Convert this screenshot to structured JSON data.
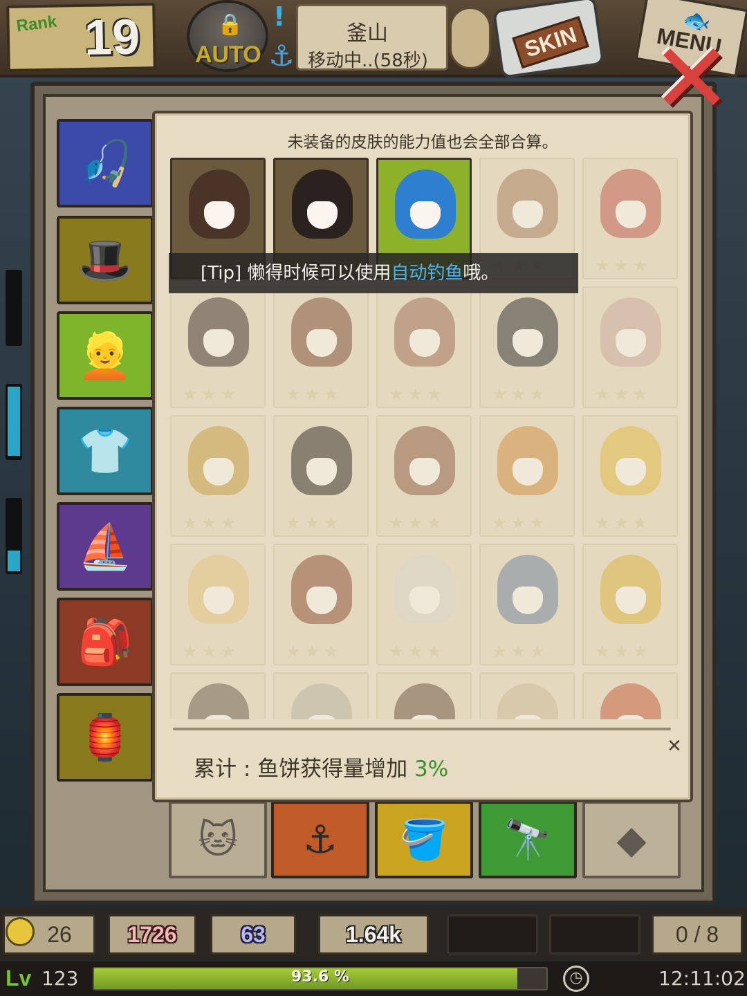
{
  "hud": {
    "rank_label": "Rank",
    "rank_value": "19",
    "auto_label": "AUTO",
    "location_name": "釜山",
    "location_status": "移动中..(58秒)",
    "skin_label": "SKIN",
    "menu_label": "MENU"
  },
  "skin_panel": {
    "header": "未装备的皮肤的能力值也会全部合算。",
    "tip_prefix": "[Tip] 懒得时候可以使用",
    "tip_link": "自动钓鱼",
    "tip_suffix": "哦。",
    "footer_label": "累计 : 鱼饼获得量增加 ",
    "footer_value": "3%",
    "star_glyphs": "★★★",
    "close_glyph": "✕"
  },
  "tabs": [
    {
      "name": "fishing-rod",
      "color": "#3b4aa8",
      "glyph": "🎣"
    },
    {
      "name": "hat",
      "color": "#8a7a1e",
      "glyph": "🎩"
    },
    {
      "name": "hair",
      "color": "#7fb52a",
      "glyph": "👱"
    },
    {
      "name": "clothes",
      "color": "#2f8aa0",
      "glyph": "👕"
    },
    {
      "name": "boat",
      "color": "#5e3a8f",
      "glyph": "⛵"
    },
    {
      "name": "bag",
      "color": "#8b3a25",
      "glyph": "🎒"
    },
    {
      "name": "lantern",
      "color": "#8a7a1e",
      "glyph": "🏮"
    }
  ],
  "hair_colors": [
    "#4a3428",
    "#2b2220",
    "#2f7fd0",
    "#a77a58",
    "#c0584a",
    "#3a2e2a",
    "#7a4a32",
    "#9a6a4c",
    "#2a2a2a",
    "#caa89a",
    "#c49a3c",
    "#2f2622",
    "#8a5a40",
    "#d08a3a",
    "#e2b840",
    "#e3c07a",
    "#8a4a30",
    "#d9d4c8",
    "#6d7f98",
    "#d9b03a",
    "#6a5a4a",
    "#b8b0a0",
    "#6a5040",
    "#c9b890",
    "#c45a3a"
  ],
  "unlocked_count": 3,
  "bottom_slots": [
    {
      "name": "cat",
      "color": "#cdbfa6",
      "glyph": "🐱",
      "locked": true
    },
    {
      "name": "harpoon",
      "color": "#c05a28",
      "glyph": "⚓",
      "locked": false
    },
    {
      "name": "bait-pot",
      "color": "#caa321",
      "glyph": "🪣",
      "locked": false
    },
    {
      "name": "binoculars",
      "color": "#3d9a34",
      "glyph": "🔭",
      "locked": false
    },
    {
      "name": "gem",
      "color": "#d6c8ad",
      "glyph": "◆",
      "locked": true
    }
  ],
  "resources": {
    "coins": "26",
    "fish_cake": "1726",
    "blue_gem": "63",
    "gold": "1.64k",
    "inventory": "0 / 8"
  },
  "status": {
    "lv_label": "Lv",
    "level": "123",
    "xp_percent": 93.6,
    "xp_label": "93.6 %",
    "time": "12:11:02"
  },
  "colors": {
    "tip_link": "#4fb3f0",
    "bonus_value": "#3b8f2c",
    "xp_fill": "#8cb02e",
    "close_x": "#d9423c"
  },
  "icons": {
    "alert": "!",
    "anchor": "⚓",
    "lock": "🔒",
    "fish": "🐟",
    "close": "✕",
    "clock": "◷"
  }
}
